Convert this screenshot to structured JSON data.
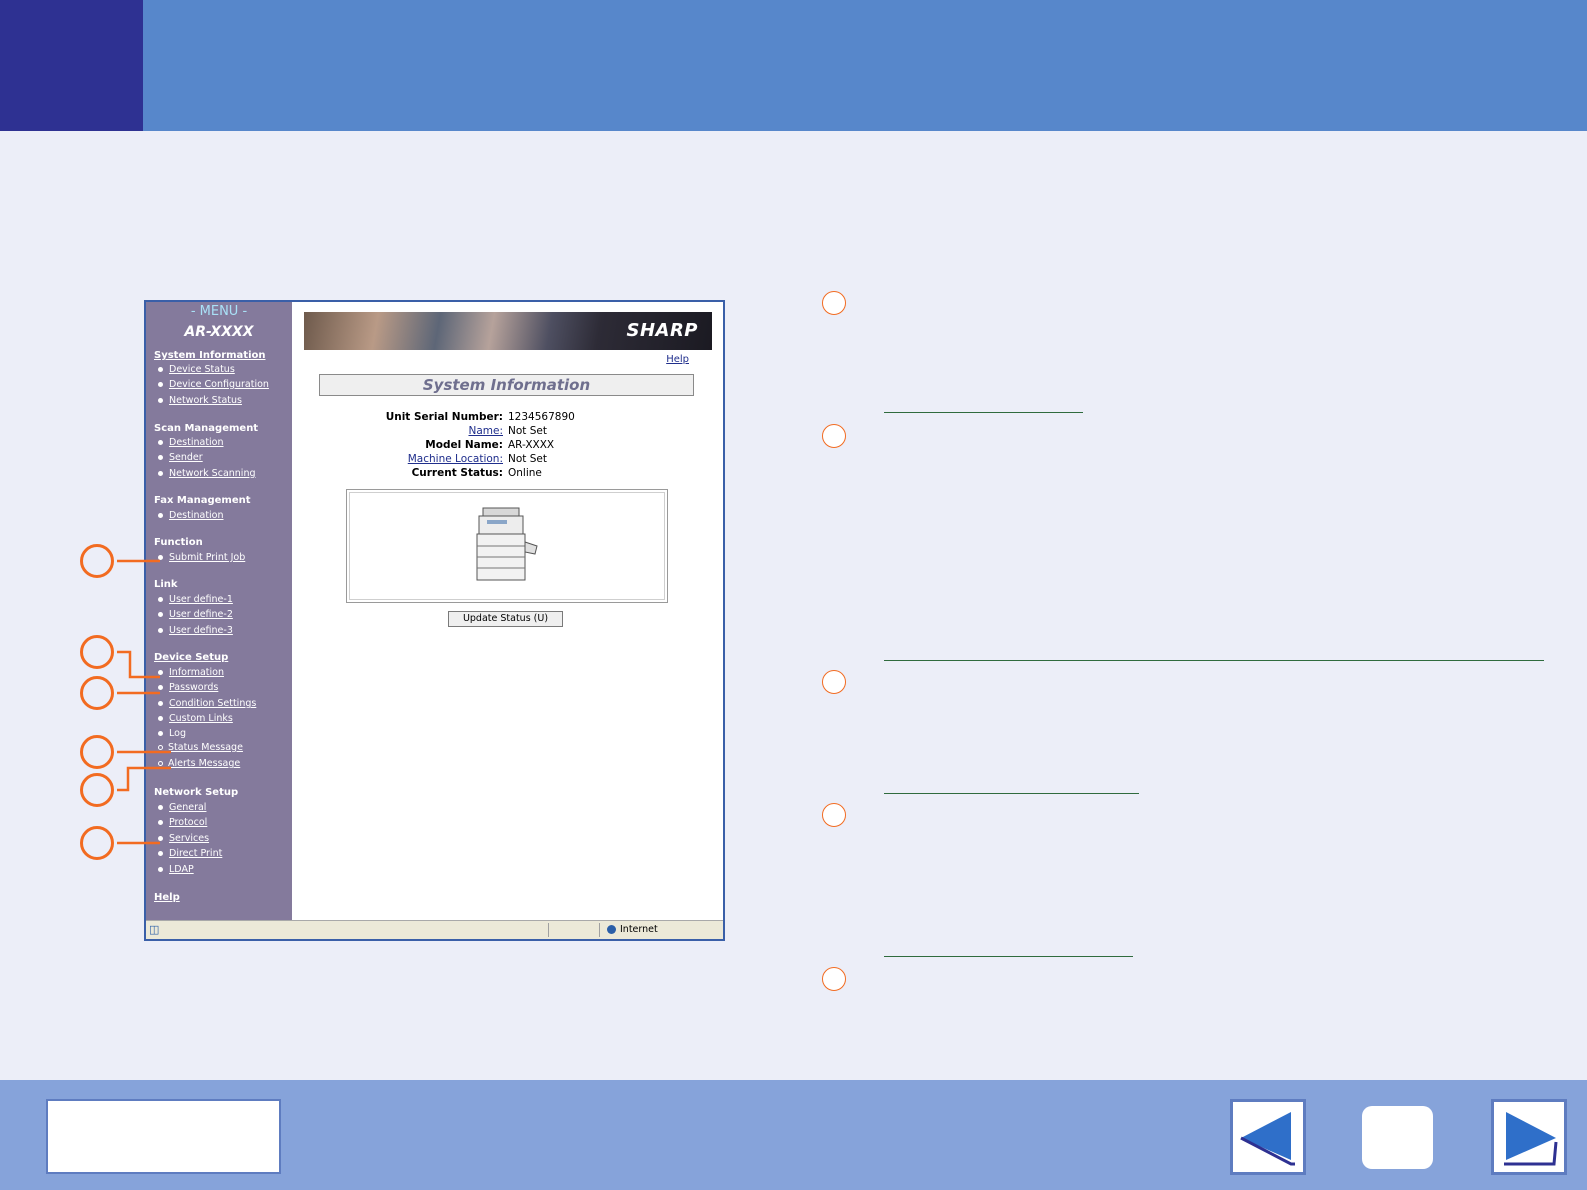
{
  "screenshot": {
    "menu": {
      "title": "- MENU -",
      "model": "AR-XXXX",
      "sections": [
        {
          "label": "System Information",
          "items": [
            "Device Status",
            "Device Configuration",
            "Network Status"
          ]
        },
        {
          "label": "Scan Management",
          "items": [
            "Destination",
            "Sender",
            "Network Scanning"
          ]
        },
        {
          "label": "Fax Management",
          "items": [
            "Destination"
          ]
        },
        {
          "label": "Function",
          "items": [
            "Submit Print Job"
          ]
        },
        {
          "label": "Link",
          "items": [
            "User define-1",
            "User define-2",
            "User define-3"
          ]
        },
        {
          "label": "Device Setup",
          "items": [
            "Information",
            "Passwords",
            "Condition Settings",
            "Custom Links",
            "Log",
            "Status Message",
            "Alerts Message"
          ]
        },
        {
          "label": "Network Setup",
          "items": [
            "General",
            "Protocol",
            "Services",
            "Direct Print",
            "LDAP"
          ]
        },
        {
          "label": "Help",
          "items": []
        }
      ]
    },
    "brand": "SHARP",
    "help": "Help",
    "title": "System Information",
    "info": [
      {
        "label": "Unit Serial Number:",
        "value": "1234567890"
      },
      {
        "label": "Name:",
        "value": "Not Set"
      },
      {
        "label": "Model Name:",
        "value": "AR-XXXX"
      },
      {
        "label": "Machine Location:",
        "value": "Not Set"
      },
      {
        "label": "Current Status:",
        "value": "Online"
      }
    ],
    "update_button": "Update Status (U)",
    "statusbar_zone": "Internet"
  },
  "colors": {
    "top_bar": "#5787CB",
    "top_block": "#2E3192",
    "bottom_bar": "#86A3DA",
    "callout": "#F26B21",
    "menu_bg": "#847A9C"
  },
  "icons": {
    "prev": "triangle-left-icon",
    "next": "triangle-right-icon"
  }
}
